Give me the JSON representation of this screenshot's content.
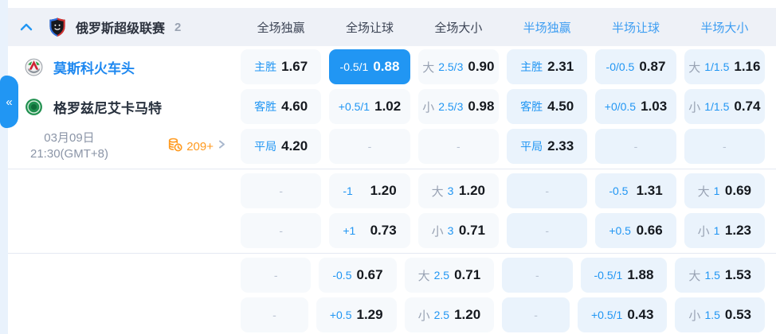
{
  "side_tab": {
    "collapse_label": "«"
  },
  "league_header": {
    "name": "俄罗斯超级联赛",
    "count": "2",
    "columns": [
      "全场独赢",
      "全场让球",
      "全场大小",
      "半场独赢",
      "半场让球",
      "半场大小"
    ]
  },
  "match": {
    "home_team": "莫斯科火车头",
    "away_team": "格罗兹尼艾卡马特",
    "date": "03月09日",
    "time": "21:30(GMT+8)",
    "markets_count": "209+"
  },
  "empty_placeholder": "-",
  "colors": {
    "accent": "#2196f3",
    "half_column_header": "#3d9df2",
    "selected_cell_bg": "#2196f3",
    "markets_orange": "#ff9a1f"
  },
  "odds_rows": [
    {
      "group": 1,
      "cells": [
        {
          "m": "主胜",
          "v": "1.67"
        },
        {
          "m": "-0.5/1",
          "v": "0.88",
          "sel": true
        },
        {
          "p": "大",
          "m": "2.5/3",
          "v": "0.90"
        },
        {
          "m": "主胜",
          "v": "2.31"
        },
        {
          "m": "-0/0.5",
          "v": "0.87"
        },
        {
          "p": "大",
          "m": "1/1.5",
          "v": "1.16"
        }
      ]
    },
    {
      "group": 1,
      "cells": [
        {
          "m": "客胜",
          "v": "4.60"
        },
        {
          "m": "+0.5/1",
          "v": "1.02"
        },
        {
          "p": "小",
          "m": "2.5/3",
          "v": "0.98"
        },
        {
          "m": "客胜",
          "v": "4.50"
        },
        {
          "m": "+0/0.5",
          "v": "1.03"
        },
        {
          "p": "小",
          "m": "1/1.5",
          "v": "0.74"
        }
      ]
    },
    {
      "group": 1,
      "cells": [
        {
          "m": "平局",
          "v": "4.20"
        },
        {
          "empty": true
        },
        {
          "empty": true
        },
        {
          "m": "平局",
          "v": "2.33"
        },
        {
          "empty": true
        },
        {
          "empty": true
        }
      ]
    },
    {
      "group": 2,
      "cells": [
        {
          "empty": true
        },
        {
          "m": "-1",
          "v": "1.20"
        },
        {
          "p": "大",
          "m": "3",
          "v": "1.20"
        },
        {
          "empty": true
        },
        {
          "m": "-0.5",
          "v": "1.31"
        },
        {
          "p": "大",
          "m": "1",
          "v": "0.69"
        }
      ]
    },
    {
      "group": 2,
      "cells": [
        {
          "empty": true
        },
        {
          "m": "+1",
          "v": "0.73"
        },
        {
          "p": "小",
          "m": "3",
          "v": "0.71"
        },
        {
          "empty": true
        },
        {
          "m": "+0.5",
          "v": "0.66"
        },
        {
          "p": "小",
          "m": "1",
          "v": "1.23"
        }
      ]
    },
    {
      "group": 3,
      "cells": [
        {
          "empty": true
        },
        {
          "m": "-0.5",
          "v": "0.67"
        },
        {
          "p": "大",
          "m": "2.5",
          "v": "0.71"
        },
        {
          "empty": true
        },
        {
          "m": "-0.5/1",
          "v": "1.88"
        },
        {
          "p": "大",
          "m": "1.5",
          "v": "1.53"
        }
      ]
    },
    {
      "group": 3,
      "cells": [
        {
          "empty": true
        },
        {
          "m": "+0.5",
          "v": "1.29"
        },
        {
          "p": "小",
          "m": "2.5",
          "v": "1.20"
        },
        {
          "empty": true
        },
        {
          "m": "+0.5/1",
          "v": "0.43"
        },
        {
          "p": "小",
          "m": "1.5",
          "v": "0.53"
        }
      ]
    }
  ]
}
